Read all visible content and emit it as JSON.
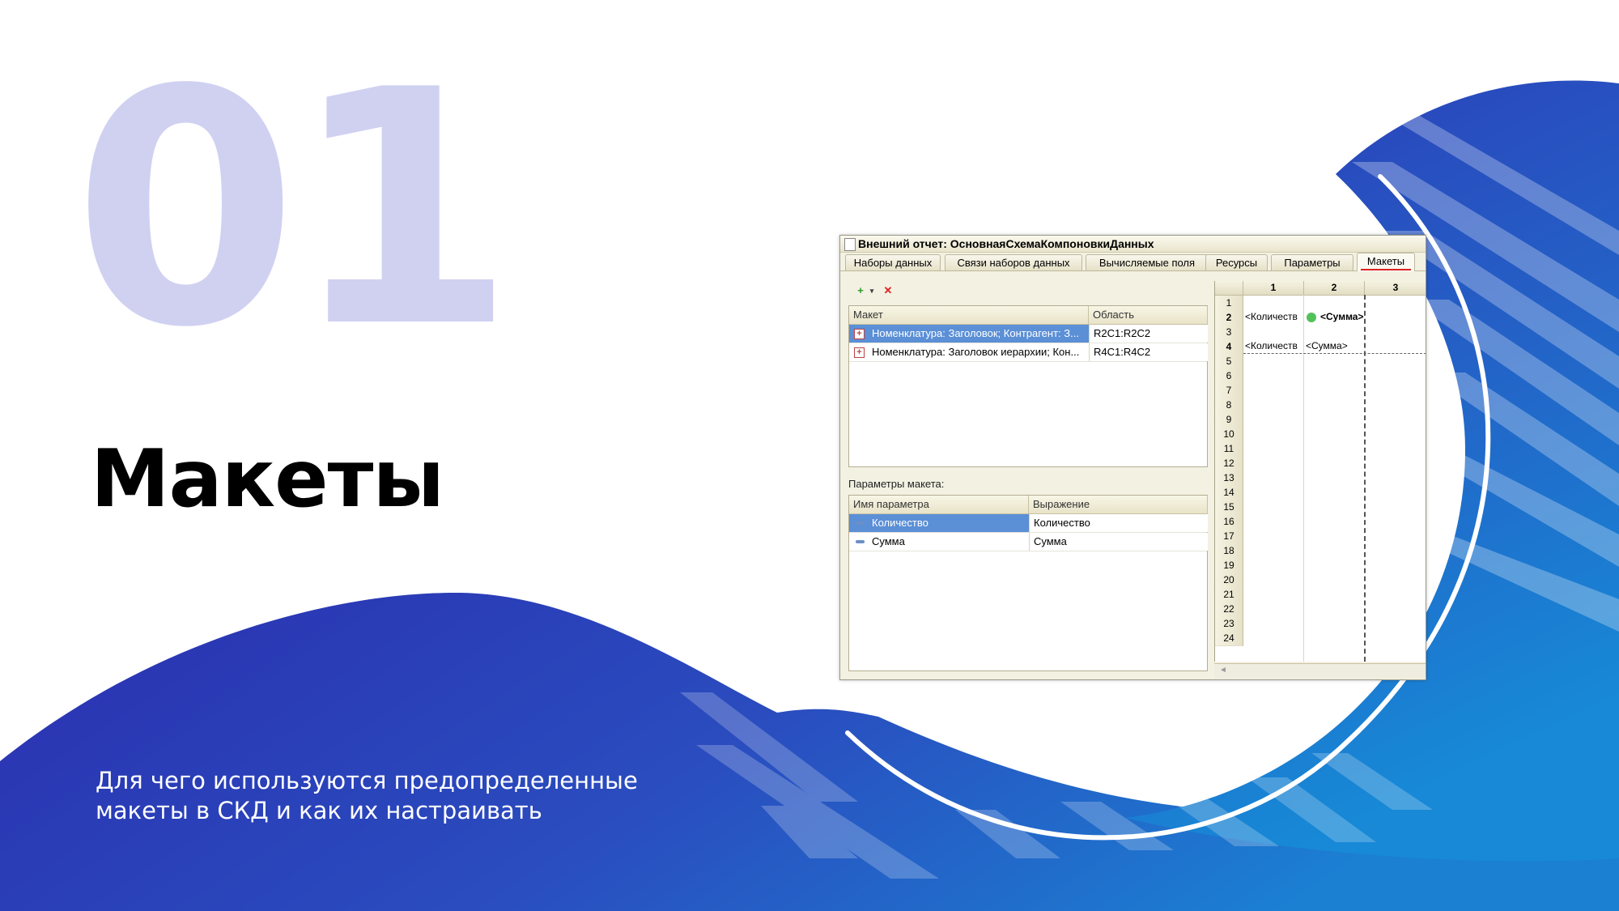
{
  "slide": {
    "number": "01",
    "title": "Макеты",
    "subtitle": "Для чего используются предопределенные макеты в СКД и как их настраивать"
  },
  "colors": {
    "primary_blue": "#2b34b2",
    "light_blue": "#1a85d6",
    "number_tint": "#d0d1f1"
  },
  "window": {
    "title": "Внешний отчет: ОсновнаяСхемаКомпоновкиДанных",
    "tabs": [
      {
        "label": "Наборы данных",
        "active": false
      },
      {
        "label": "Связи наборов данных",
        "active": false
      },
      {
        "label": "Вычисляемые поля",
        "active": false
      },
      {
        "label": "Ресурсы",
        "active": false
      },
      {
        "label": "Параметры",
        "active": false
      },
      {
        "label": "Макеты",
        "active": true
      }
    ],
    "toolbar": {
      "add_icon": "add-icon",
      "delete_icon": "delete-icon"
    },
    "layouts_table": {
      "columns": [
        "Макет",
        "Область"
      ],
      "rows": [
        {
          "layout": "Номенклатура: Заголовок; Контрагент: З...",
          "area": "R2C1:R2C2",
          "selected": true
        },
        {
          "layout": "Номенклатура: Заголовок иерархии; Кон...",
          "area": "R4C1:R4C2",
          "selected": false
        }
      ]
    },
    "params_label": "Параметры макета:",
    "params_table": {
      "columns": [
        "Имя параметра",
        "Выражение"
      ],
      "rows": [
        {
          "name": "Количество",
          "expression": "Количество",
          "selected": true
        },
        {
          "name": "Сумма",
          "expression": "Сумма",
          "selected": false
        }
      ]
    },
    "sheet": {
      "columns": [
        "1",
        "2",
        "3"
      ],
      "rows": [
        "1",
        "2",
        "3",
        "4",
        "5",
        "6",
        "7",
        "8",
        "9",
        "10",
        "11",
        "12",
        "13",
        "14",
        "15",
        "16",
        "17",
        "18",
        "19",
        "20",
        "21",
        "22",
        "23",
        "24"
      ],
      "cells": [
        {
          "row": "2",
          "col1": "<Количеств",
          "col2": "<Сумма>"
        },
        {
          "row": "4",
          "col1": "<Количеств",
          "col2": "<Сумма>"
        }
      ]
    }
  }
}
